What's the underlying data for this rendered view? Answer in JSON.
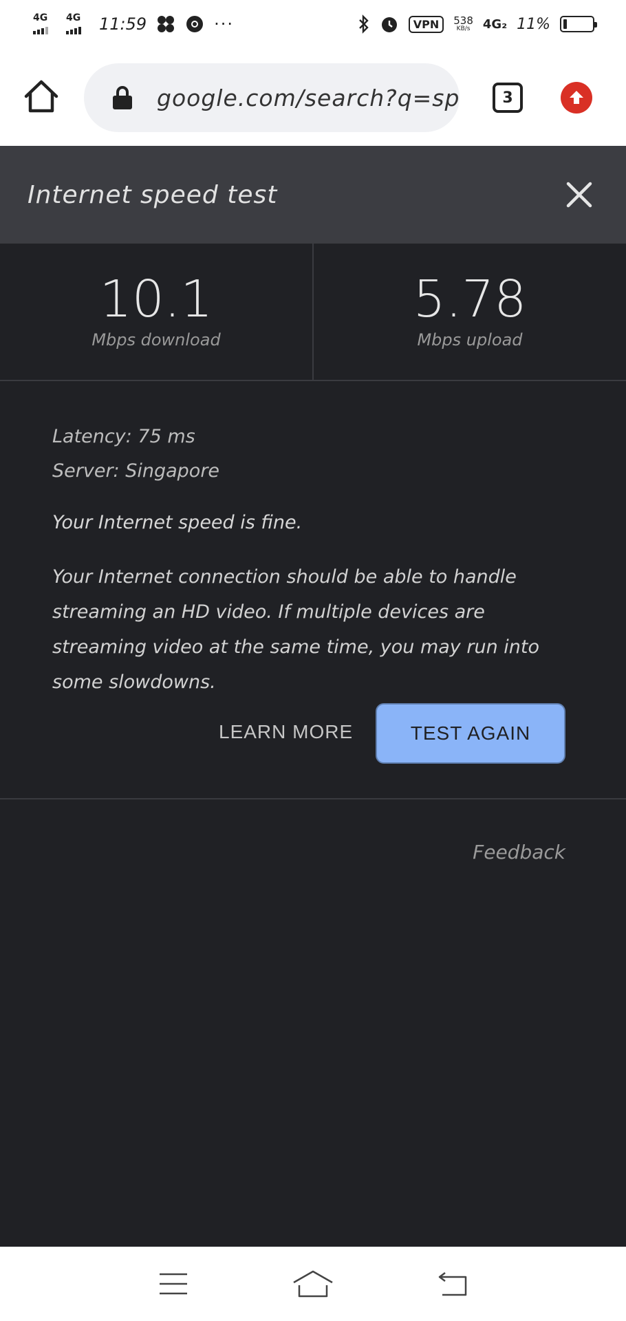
{
  "status_bar": {
    "signal1_label": "4G",
    "signal2_label": "4G",
    "time": "11:59",
    "more": "···",
    "vpn_label": "VPN",
    "speed_value": "538",
    "speed_unit": "KB/s",
    "network_label": "4G₂",
    "battery_percent": "11%",
    "battery_level": 0.11
  },
  "toolbar": {
    "url": "google.com/search?q=speedtes",
    "tab_count": "3"
  },
  "speed_test": {
    "title": "Internet speed test",
    "download_value": "10.1",
    "download_unit": "Mbps download",
    "upload_value": "5.78",
    "upload_unit": "Mbps upload",
    "latency": "Latency: 75 ms",
    "server": "Server: Singapore",
    "verdict": "Your Internet speed is fine.",
    "description": "Your Internet connection should be able to handle streaming an HD video. If multiple devices are streaming video at the same time, you may run into some slowdowns.",
    "learn_more_label": "LEARN MORE",
    "test_again_label": "TEST AGAIN",
    "feedback_label": "Feedback"
  },
  "colors": {
    "background": "#202125",
    "header": "#3c3d42",
    "accent_button": "#8ab4f8",
    "update_badge": "#d93025"
  }
}
